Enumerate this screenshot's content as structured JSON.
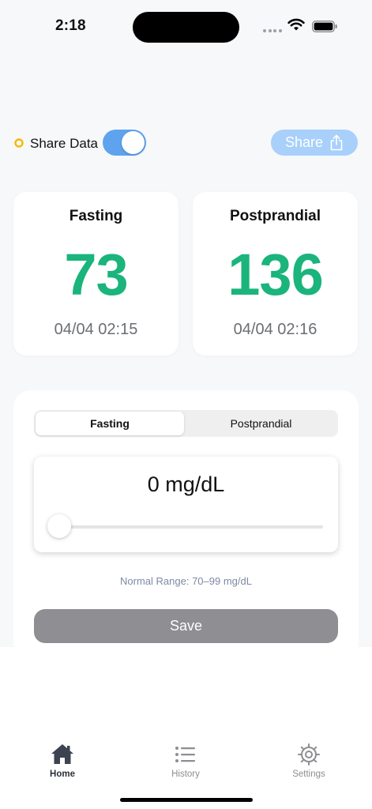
{
  "status_bar": {
    "time": "2:18"
  },
  "share": {
    "label": "Share Data",
    "toggle_on": true,
    "button_label": "Share",
    "accent_color": "#5fa3ef"
  },
  "readings": [
    {
      "title": "Fasting",
      "value": "73",
      "timestamp": "04/04 02:15",
      "value_color": "#1ab47c"
    },
    {
      "title": "Postprandial",
      "value": "136",
      "timestamp": "04/04 02:16",
      "value_color": "#1ab47c"
    }
  ],
  "input_panel": {
    "segments": [
      {
        "label": "Fasting",
        "selected": true
      },
      {
        "label": "Postprandial",
        "selected": false
      }
    ],
    "value_display": "0 mg/dL",
    "slider_fraction": 0,
    "normal_range": "Normal Range: 70–99 mg/dL",
    "save_label": "Save"
  },
  "tab_bar": {
    "items": [
      {
        "label": "Home",
        "icon": "house-icon",
        "active": true
      },
      {
        "label": "History",
        "icon": "list-icon",
        "active": false
      },
      {
        "label": "Settings",
        "icon": "gear-icon",
        "active": false
      }
    ]
  }
}
